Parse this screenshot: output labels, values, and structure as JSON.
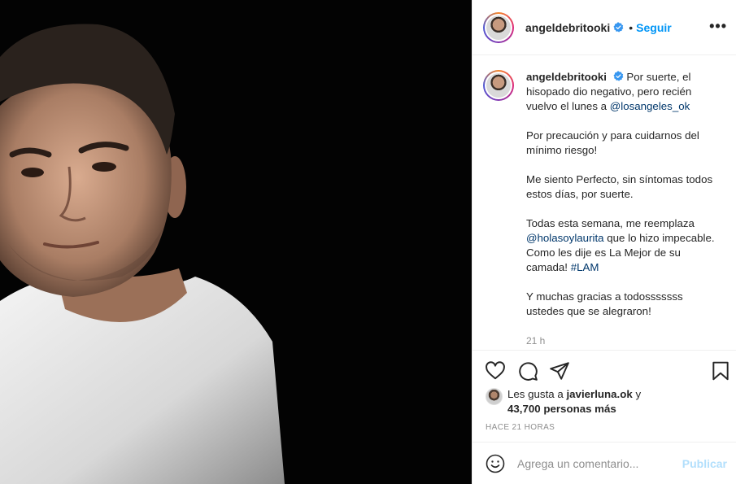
{
  "post": {
    "username": "angeldebritooki",
    "dot": "•",
    "follow_label": "Seguir",
    "more_label": "•••",
    "caption": {
      "username": "angeldebritooki",
      "p1_before": "Por suerte, el hisopado dio negativo, pero recién vuelvo el lunes a ",
      "p1_mention": "@losangeles_ok",
      "p2": "Por precaución y para cuidarnos del mínimo riesgo!",
      "p3": "Me siento Perfecto, sin síntomas todos estos días, por suerte.",
      "p4_before": "Todas esta semana, me reemplaza ",
      "p4_mention": "@holasoylaurita",
      "p4_mid": " que lo hizo impecable. Como les dije es La Mejor de su camada! ",
      "p4_hashtag": "#LAM",
      "p5": "Y muchas gracias a todosssssss ustedes que se alegraron!"
    },
    "time_label": "21 h",
    "likes": {
      "prefix": "Les gusta a ",
      "user": "javierluna.ok",
      "mid": " y",
      "count": "43,700 personas más"
    },
    "ago_label": "HACE 21 HORAS",
    "comment": {
      "placeholder": "Agrega un comentario...",
      "publish_label": "Publicar"
    }
  },
  "icons": {
    "verified": "verified-badge-icon",
    "like": "heart-icon",
    "comment": "comment-bubble-icon",
    "share": "paper-plane-icon",
    "save": "bookmark-icon",
    "emoji": "emoji-icon"
  },
  "colors": {
    "accent": "#0095f6",
    "link": "#00376b",
    "muted": "#8e8e8e",
    "publish_disabled": "#b2dffc"
  }
}
